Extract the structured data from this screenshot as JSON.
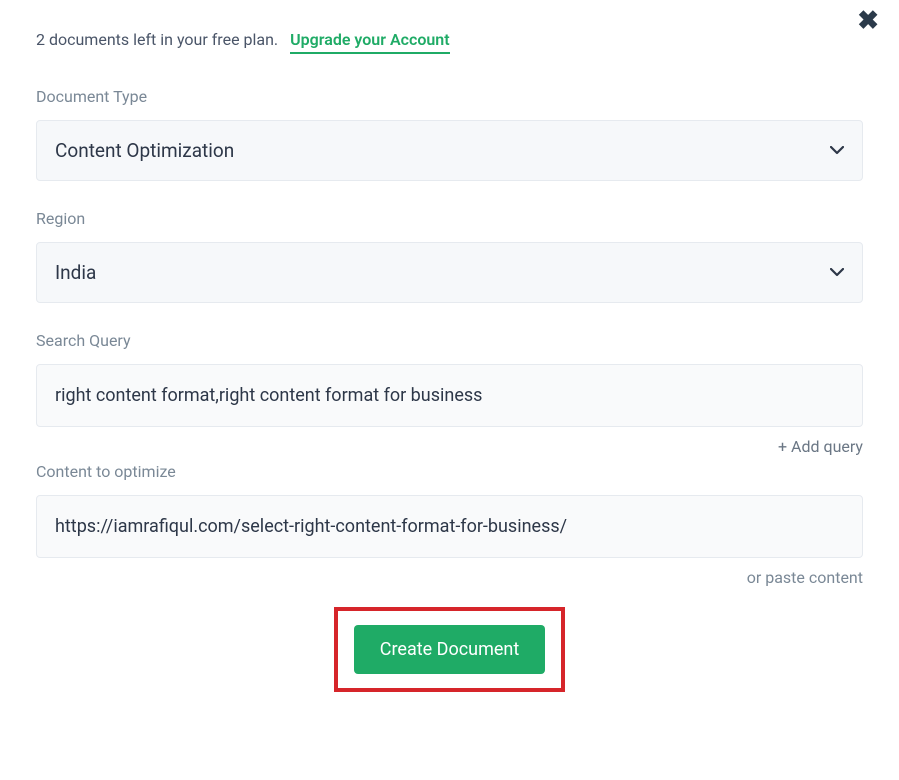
{
  "close_icon": "✖",
  "top": {
    "plan_text": "2 documents left in your free plan.",
    "upgrade_text": "Upgrade your Account"
  },
  "doc_type": {
    "label": "Document Type",
    "value": "Content Optimization"
  },
  "region": {
    "label": "Region",
    "value": "India"
  },
  "search_query": {
    "label": "Search Query",
    "value": "right content format,right content format for business",
    "add_query": "+ Add query"
  },
  "content_optimize": {
    "label": "Content to optimize",
    "value": "https://iamrafiqul.com/select-right-content-format-for-business/",
    "paste_hint": "or paste content"
  },
  "create_button": "Create Document"
}
